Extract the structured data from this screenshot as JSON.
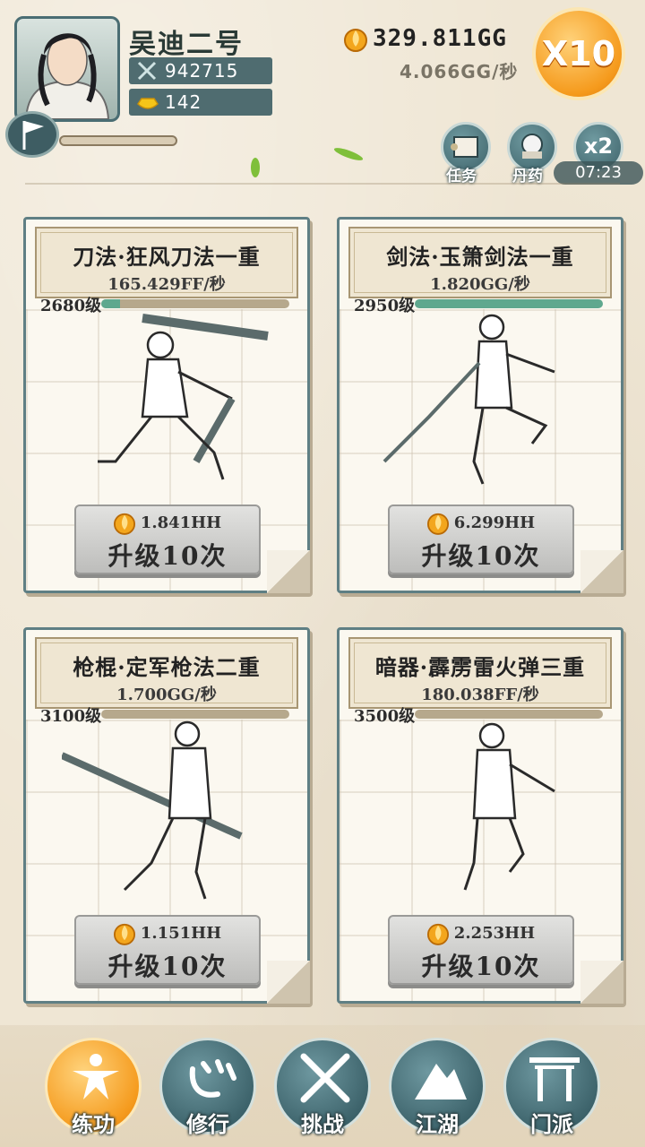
{
  "player": {
    "name": "吴迪二号",
    "power": "942715",
    "ingots": "142"
  },
  "currency": {
    "gold": "329.811GG",
    "rate": "4.066GG/秒"
  },
  "boost": {
    "label": "X10"
  },
  "actions": [
    {
      "label": "任务",
      "icon": "scroll-icon"
    },
    {
      "label": "丹药",
      "icon": "pill-icon"
    },
    {
      "label": "x2",
      "icon": "double-speed-icon"
    }
  ],
  "timer": "07:23",
  "skills": [
    {
      "name": "刀法·狂风刀法一重",
      "rate": "165.429FF/秒",
      "level": "2680级",
      "level_progress": 0.1,
      "cost": "1.841HH",
      "button": "升级10次"
    },
    {
      "name": "剑法·玉箫剑法一重",
      "rate": "1.820GG/秒",
      "level": "2950级",
      "level_progress": 1.0,
      "cost": "6.299HH",
      "button": "升级10次"
    },
    {
      "name": "枪棍·定军枪法二重",
      "rate": "1.700GG/秒",
      "level": "3100级",
      "level_progress": 0.0,
      "cost": "1.151HH",
      "button": "升级10次"
    },
    {
      "name": "暗器·霹雳雷火弹三重",
      "rate": "180.038FF/秒",
      "level": "3500级",
      "level_progress": 0.0,
      "cost": "2.253HH",
      "button": "升级10次"
    }
  ],
  "nav": [
    {
      "label": "练功",
      "active": true
    },
    {
      "label": "修行",
      "active": false
    },
    {
      "label": "挑战",
      "active": false
    },
    {
      "label": "江湖",
      "active": false
    },
    {
      "label": "门派",
      "active": false
    }
  ],
  "colors": {
    "accent_orange": "#f59a1c",
    "teal": "#4f6c70",
    "level_green": "#5fa88e",
    "paper": "#fbf8f0"
  }
}
